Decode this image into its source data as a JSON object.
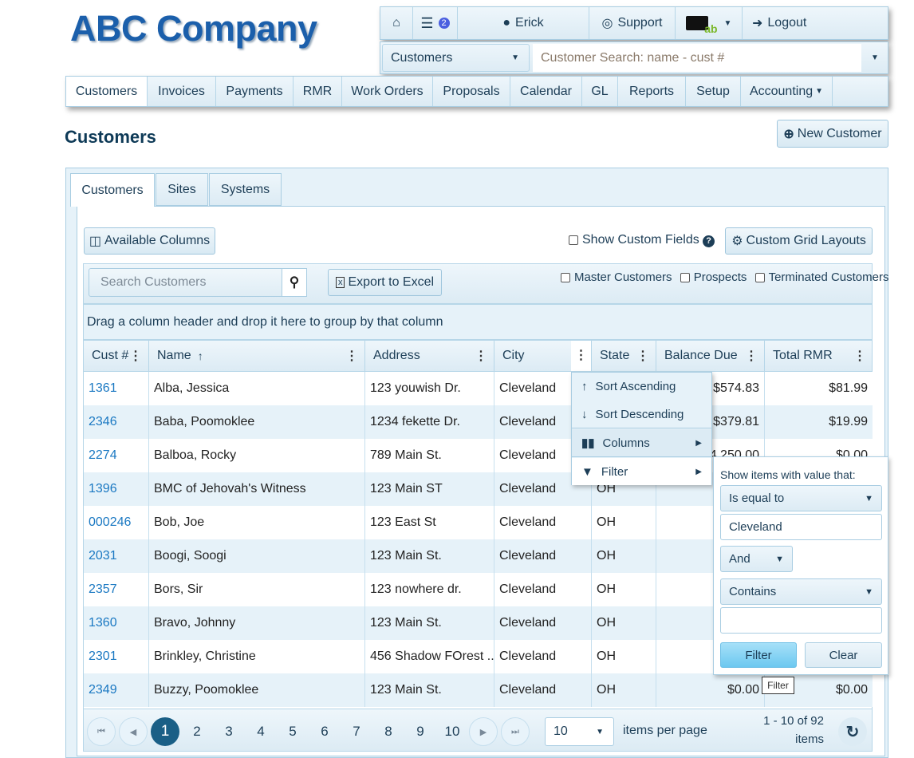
{
  "logo": "ABC Company",
  "topbar": {
    "notification_count": "2",
    "user": "Erick",
    "support": "Support",
    "logout": "Logout",
    "briefcase_badge": "ab"
  },
  "search": {
    "module": "Customers",
    "placeholder": "Customer Search: name - cust #"
  },
  "nav": [
    {
      "label": "Customers"
    },
    {
      "label": "Invoices"
    },
    {
      "label": "Payments"
    },
    {
      "label": "RMR"
    },
    {
      "label": "Work Orders"
    },
    {
      "label": "Proposals"
    },
    {
      "label": "Calendar"
    },
    {
      "label": "GL"
    },
    {
      "label": "Reports"
    },
    {
      "label": "Setup"
    },
    {
      "label": "Accounting"
    }
  ],
  "page": {
    "title": "Customers",
    "new_button": "New Customer"
  },
  "tabs": [
    {
      "label": "Customers"
    },
    {
      "label": "Sites"
    },
    {
      "label": "Systems"
    }
  ],
  "toolbar": {
    "available_columns": "Available Columns",
    "show_custom_fields": "Show Custom Fields",
    "custom_grid_layouts": "Custom Grid Layouts",
    "search_placeholder": "Search Customers",
    "export": "Export to Excel",
    "master": "Master Customers",
    "prospects": "Prospects",
    "terminated": "Terminated Customers"
  },
  "group_hint": "Drag a column header and drop it here to group by that column",
  "columns": [
    "Cust #",
    "Name",
    "Address",
    "City",
    "State",
    "Balance Due",
    "Total RMR"
  ],
  "rows": [
    [
      "1361",
      "Alba, Jessica",
      "123 youwish Dr.",
      "Cleveland",
      "",
      "$574.83",
      "$81.99"
    ],
    [
      "2346",
      "Baba, Poomoklee",
      "1234 fekette Dr.",
      "Cleveland",
      "",
      "$379.81",
      "$19.99"
    ],
    [
      "2274",
      "Balboa, Rocky",
      "789 Main St.",
      "Cleveland",
      "",
      "$4,250.00",
      "$0.00"
    ],
    [
      "1396",
      "BMC of Jehovah's Witness",
      "123 Main ST",
      "Cleveland",
      "OH",
      "",
      ""
    ],
    [
      "000246",
      "Bob, Joe",
      "123 East St",
      "Cleveland",
      "OH",
      "($",
      ""
    ],
    [
      "2031",
      "Boogi, Soogi",
      "123 Main St.",
      "Cleveland",
      "OH",
      "",
      ""
    ],
    [
      "2357",
      "Bors, Sir",
      "123 nowhere dr.",
      "Cleveland",
      "OH",
      "",
      ""
    ],
    [
      "1360",
      "Bravo, Johnny",
      "123 Main St.",
      "Cleveland",
      "OH",
      "$",
      ""
    ],
    [
      "2301",
      "Brinkley, Christine",
      "456 Shadow FOrest ...",
      "Cleveland",
      "OH",
      "",
      ""
    ],
    [
      "2349",
      "Buzzy, Poomoklee",
      "123 Main St.",
      "Cleveland",
      "OH",
      "$0.00",
      "$0.00"
    ]
  ],
  "column_menu": {
    "sort_asc": "Sort Ascending",
    "sort_desc": "Sort Descending",
    "columns": "Columns",
    "filter": "Filter"
  },
  "filter_popup": {
    "title": "Show items with value that:",
    "operator1": "Is equal to",
    "value1": "Cleveland",
    "logic": "And",
    "operator2": "Contains",
    "value2": "",
    "filter_button": "Filter",
    "clear_button": "Clear",
    "tooltip": "Filter"
  },
  "pager": {
    "pages": [
      "1",
      "2",
      "3",
      "4",
      "5",
      "6",
      "7",
      "8",
      "9",
      "10"
    ],
    "current": "1",
    "page_size": "10",
    "items_per_page": "items per page",
    "summary_line1": "1 - 10 of 92",
    "summary_line2": "items"
  },
  "colors": {
    "brand": "#1b5fab",
    "link": "#1a78c2",
    "active_page": "#1a5f86",
    "filter_button": "#7fd0f3"
  }
}
